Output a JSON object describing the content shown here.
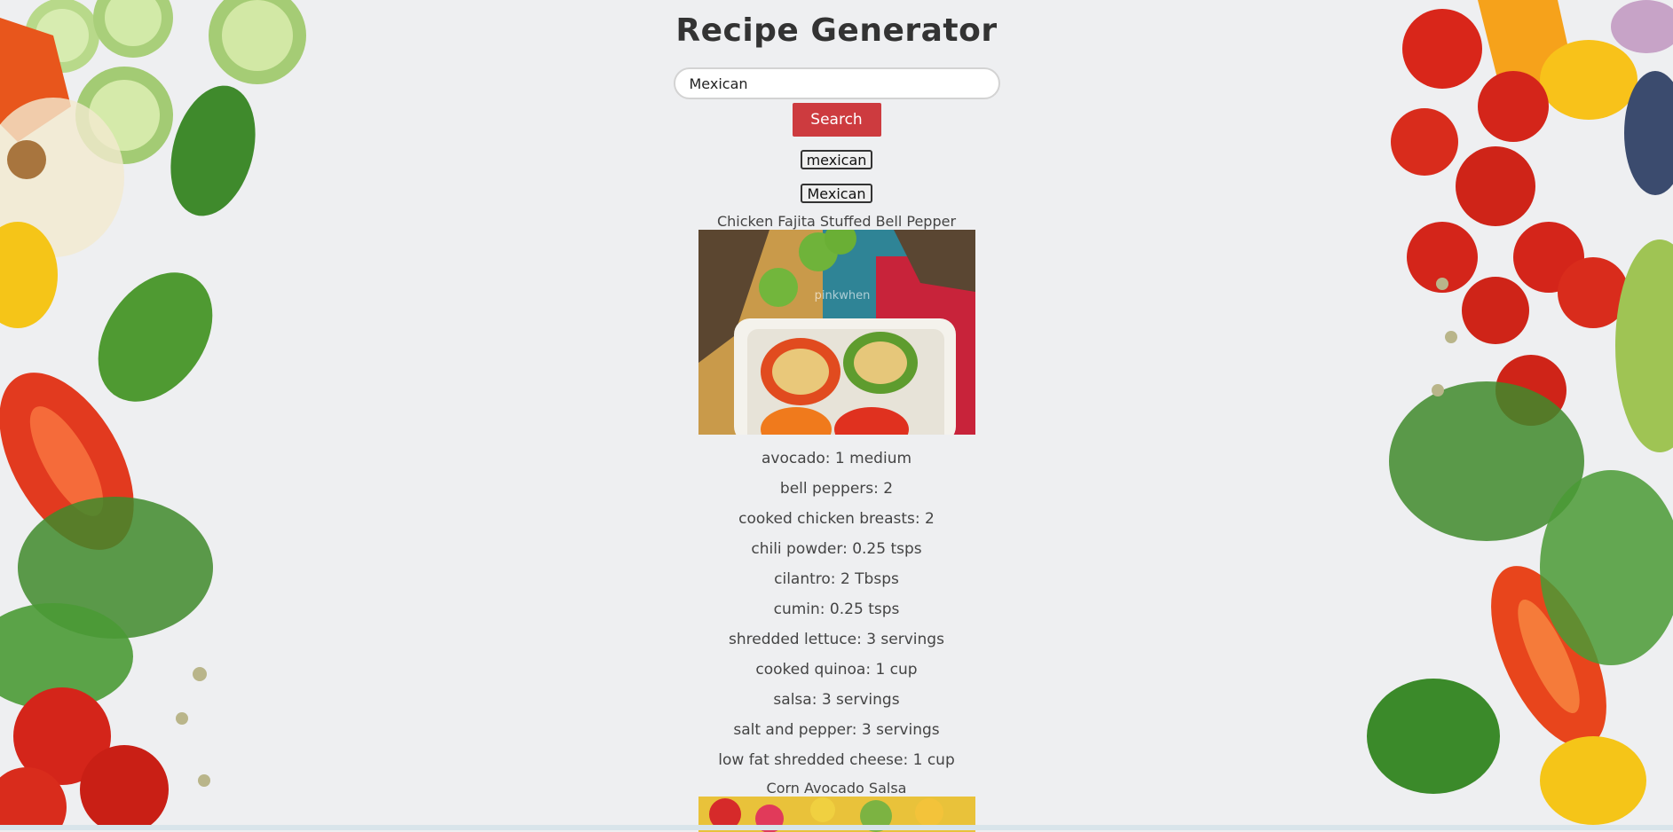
{
  "app": {
    "title": "Recipe Generator"
  },
  "search": {
    "value": "Mexican",
    "button_label": "Search"
  },
  "filters": [
    "mexican",
    "Mexican"
  ],
  "recipes": [
    {
      "title": "Chicken Fajita Stuffed Bell Pepper",
      "image_watermark": "pinkwhen",
      "ingredients": [
        "avocado: 1 medium",
        "bell peppers: 2",
        "cooked chicken breasts: 2",
        "chili powder: 0.25 tsps",
        "cilantro: 2 Tbsps",
        "cumin: 0.25 tsps",
        "shredded lettuce: 3 servings",
        "cooked quinoa: 1 cup",
        "salsa: 3 servings",
        "salt and pepper: 3 servings",
        "low fat shredded cheese: 1 cup"
      ]
    },
    {
      "title": "Corn Avocado Salsa"
    }
  ],
  "colors": {
    "accent": "#cd3b3f",
    "background": "#eeeff1",
    "text": "#333333"
  }
}
